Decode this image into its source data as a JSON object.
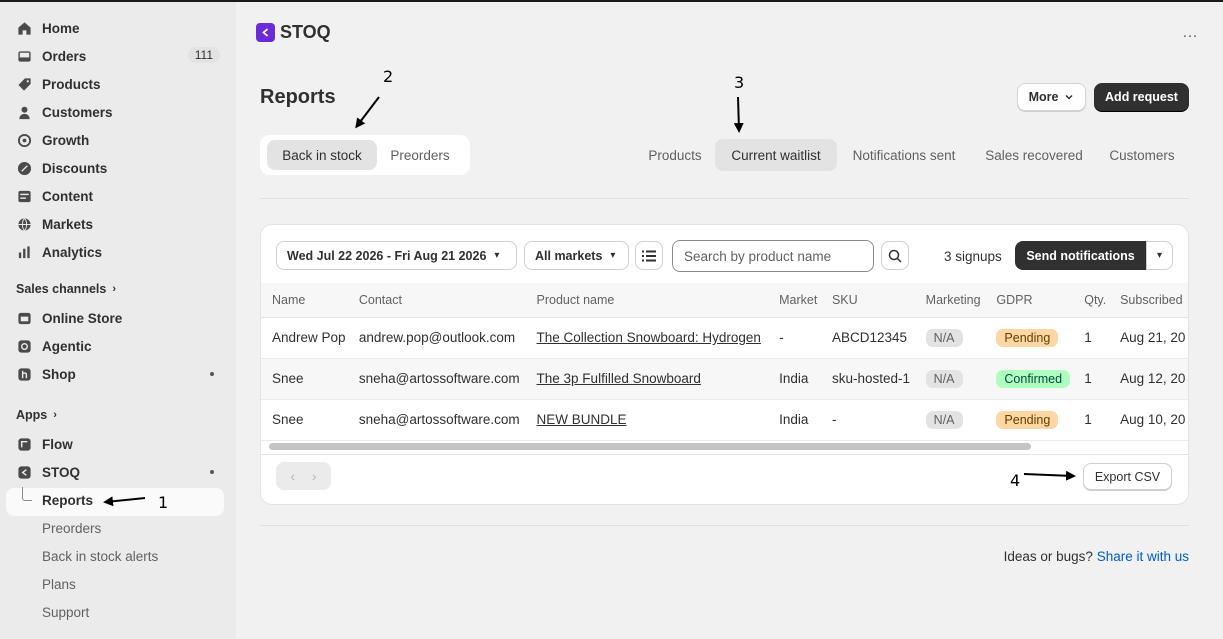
{
  "sidebar": {
    "items": [
      {
        "label": "Home",
        "icon": "home-icon"
      },
      {
        "label": "Orders",
        "icon": "inbox-icon",
        "badge": "111"
      },
      {
        "label": "Products",
        "icon": "tag-icon"
      },
      {
        "label": "Customers",
        "icon": "person-icon"
      },
      {
        "label": "Growth",
        "icon": "target-icon"
      },
      {
        "label": "Discounts",
        "icon": "discount-icon"
      },
      {
        "label": "Content",
        "icon": "content-icon"
      },
      {
        "label": "Markets",
        "icon": "globe-icon"
      },
      {
        "label": "Analytics",
        "icon": "bar-chart-icon"
      }
    ],
    "sales_channels_title": "Sales channels",
    "sales_channels": [
      {
        "label": "Online Store",
        "icon": "store-icon"
      },
      {
        "label": "Agentic",
        "icon": "agentic-icon"
      },
      {
        "label": "Shop",
        "icon": "shop-icon"
      }
    ],
    "apps_title": "Apps",
    "apps": [
      {
        "label": "Flow",
        "icon": "flow-icon"
      },
      {
        "label": "STOQ",
        "icon": "stoq-icon"
      }
    ],
    "stoq_sub": [
      "Reports",
      "Preorders",
      "Back in stock alerts",
      "Plans",
      "Support"
    ]
  },
  "header": {
    "app_name": "STOQ",
    "menu": "…"
  },
  "page": {
    "title": "Reports",
    "more_label": "More",
    "add_label": "Add request",
    "segments": [
      "Back in stock",
      "Preorders"
    ],
    "tabs": [
      "Products",
      "Current waitlist",
      "Notifications sent",
      "Sales recovered",
      "Customers"
    ]
  },
  "filters": {
    "date_range": "Wed Jul 22 2026 - Fri Aug 21 2026",
    "markets": "All markets",
    "search_placeholder": "Search by product name",
    "signups": "3 signups",
    "send_label": "Send notifications"
  },
  "table": {
    "columns": [
      "Name",
      "Contact",
      "Product name",
      "Market",
      "SKU",
      "Marketing",
      "GDPR",
      "Qty.",
      "Subscribed"
    ],
    "rows": [
      {
        "name": "Andrew Pop",
        "contact": "andrew.pop@outlook.com",
        "product": "The Collection Snowboard: Hydrogen",
        "market": "-",
        "sku": "ABCD12345",
        "marketing": "N/A",
        "gdpr": "Pending",
        "qty": "1",
        "subscribed": "Aug 21, 20"
      },
      {
        "name": "Snee",
        "contact": "sneha@artossoftware.com",
        "product": "The 3p Fulfilled Snowboard",
        "market": "India",
        "sku": "sku-hosted-1",
        "marketing": "N/A",
        "gdpr": "Confirmed",
        "qty": "1",
        "subscribed": "Aug 12, 20"
      },
      {
        "name": "Snee",
        "contact": "sneha@artossoftware.com",
        "product": "NEW BUNDLE",
        "market": "India",
        "sku": "-",
        "marketing": "N/A",
        "gdpr": "Pending",
        "qty": "1",
        "subscribed": "Aug 10, 20"
      }
    ]
  },
  "footer": {
    "pager_prev": "‹",
    "pager_next": "›",
    "export_label": "Export CSV",
    "ideas_text": "Ideas or bugs?",
    "ideas_link": "Share it with us"
  },
  "annotations": [
    "1",
    "2",
    "3",
    "4"
  ],
  "colors": {
    "accent": "#6c2bd9",
    "link": "#005bd3",
    "pending": "#ffd6a4",
    "confirmed": "#affebf"
  }
}
